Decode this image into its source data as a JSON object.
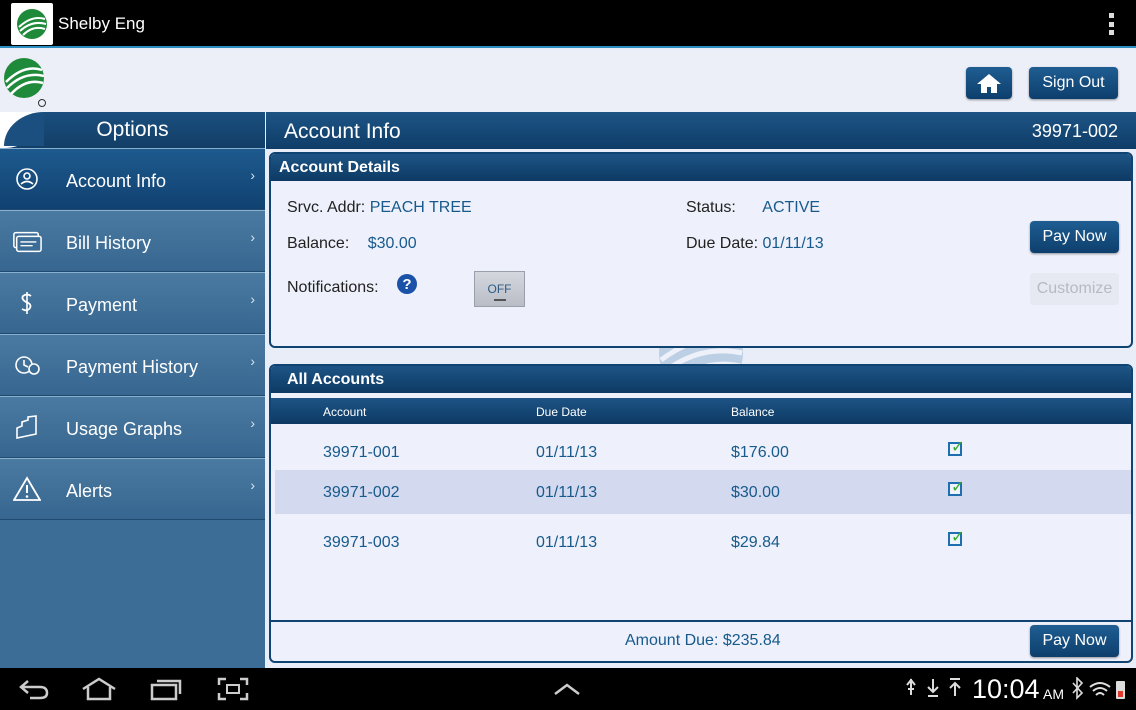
{
  "app": {
    "title": "Shelby Eng"
  },
  "header": {
    "signout_label": "Sign Out"
  },
  "sidebar": {
    "title": "Options",
    "items": [
      {
        "label": "Account Info",
        "icon": "user-circle-icon",
        "active": true
      },
      {
        "label": "Bill History",
        "icon": "bill-icon",
        "active": false
      },
      {
        "label": "Payment",
        "icon": "dollar-icon",
        "active": false
      },
      {
        "label": "Payment History",
        "icon": "history-icon",
        "active": false
      },
      {
        "label": "Usage Graphs",
        "icon": "graph-icon",
        "active": false
      },
      {
        "label": "Alerts",
        "icon": "warning-icon",
        "active": false
      }
    ]
  },
  "main": {
    "title": "Account Info",
    "account_number": "39971-002"
  },
  "details": {
    "heading": "Account Details",
    "srvc_label": "Srvc. Addr:",
    "srvc_value": "PEACH TREE",
    "balance_label": "Balance:",
    "balance_value": "$30.00",
    "notifications_label": "Notifications:",
    "toggle_label": "OFF",
    "status_label": "Status:",
    "status_value": "ACTIVE",
    "due_label": "Due Date:",
    "due_value": "01/11/13",
    "pay_now_label": "Pay Now",
    "customize_label": "Customize"
  },
  "accounts": {
    "heading": "All Accounts",
    "columns": [
      "Account",
      "Due Date",
      "Balance"
    ],
    "rows": [
      {
        "account": "39971-001",
        "due": "01/11/13",
        "balance": "$176.00",
        "checked": true
      },
      {
        "account": "39971-002",
        "due": "01/11/13",
        "balance": "$30.00",
        "checked": true
      },
      {
        "account": "39971-003",
        "due": "01/11/13",
        "balance": "$29.84",
        "checked": true
      }
    ],
    "amount_due_label": "Amount Due:",
    "amount_due_value": "$235.84",
    "pay_now_label": "Pay Now"
  },
  "statusbar": {
    "time": "10:04",
    "ampm": "AM"
  },
  "colors": {
    "primary": "#0f3d68",
    "accent_blue": "#175a8c",
    "sidebar": "#3c6d96"
  }
}
